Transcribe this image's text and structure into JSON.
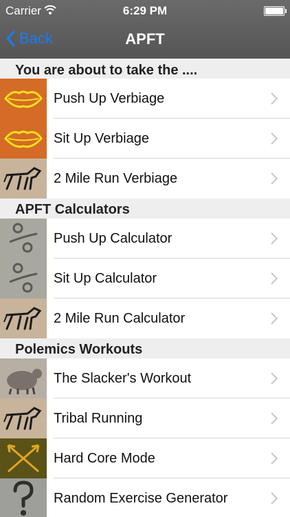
{
  "status": {
    "carrier": "Carrier",
    "time": "6:29 PM"
  },
  "nav": {
    "back_label": "Back",
    "title": "APFT"
  },
  "colors": {
    "accent": "#1a7cf5",
    "navbar": "#5f5f5f",
    "orange_thumb": "#d46b26"
  },
  "sections": [
    {
      "header": "You are about to take the ....",
      "items": [
        {
          "label": "Push Up Verbiage",
          "icon": "lips-icon"
        },
        {
          "label": "Sit Up Verbiage",
          "icon": "lips-icon"
        },
        {
          "label": "2 Mile Run Verbiage",
          "icon": "horse-icon"
        }
      ]
    },
    {
      "header": "APFT Calculators",
      "items": [
        {
          "label": "Push Up Calculator",
          "icon": "percent-icon"
        },
        {
          "label": "Sit Up Calculator",
          "icon": "percent-icon"
        },
        {
          "label": "2 Mile Run Calculator",
          "icon": "horse-icon"
        }
      ]
    },
    {
      "header": "Polemics Workouts",
      "items": [
        {
          "label": "The Slacker's Workout",
          "icon": "bear-icon"
        },
        {
          "label": "Tribal Running",
          "icon": "horse-icon"
        },
        {
          "label": "Hard Core Mode",
          "icon": "crossed-arrows-icon"
        },
        {
          "label": "Random Exercise Generator",
          "icon": "question-mark-icon"
        }
      ]
    }
  ]
}
